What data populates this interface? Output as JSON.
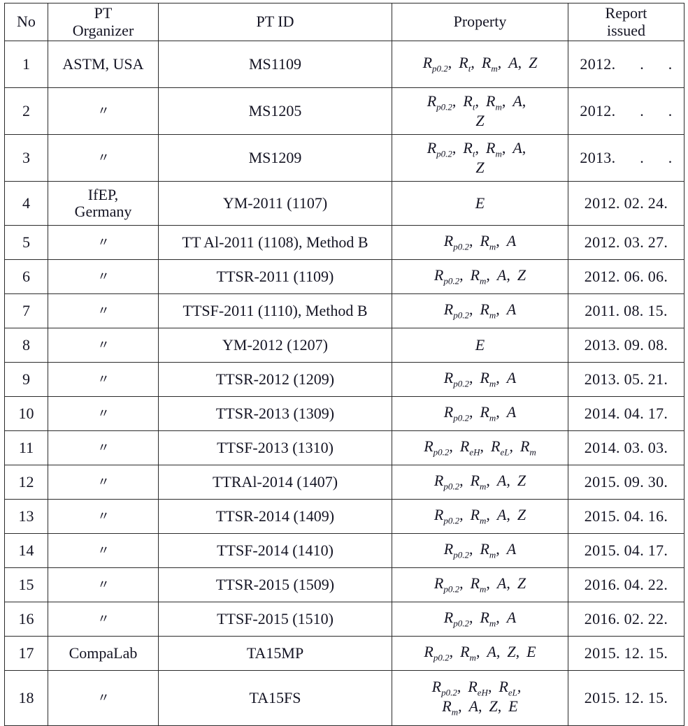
{
  "table": {
    "headers": {
      "no": "No",
      "organizer_line1": "PT",
      "organizer_line2": "Organizer",
      "pt_id": "PT  ID",
      "property": "Property",
      "report_line1": "Report",
      "report_line2": "issued"
    },
    "ditto_mark": "〃",
    "rows": [
      {
        "no": "1",
        "organizer": "ASTM,  USA",
        "organizer_is_ditto": false,
        "pt_id": "MS1109",
        "property_text": "Rp0.2,  Rt,  Rm,  A,  Z",
        "property_tokens": [
          "Rp0.2",
          "Rt",
          "Rm",
          "A",
          "Z"
        ],
        "report": "2012.      .      ."
      },
      {
        "no": "2",
        "organizer": "〃",
        "organizer_is_ditto": true,
        "pt_id": "MS1205",
        "property_text": "Rp0.2,  Rt,  Rm,  A, Z",
        "property_tokens": [
          "Rp0.2",
          "Rt",
          "Rm",
          "A",
          "Z"
        ],
        "report": "2012.      .      ."
      },
      {
        "no": "3",
        "organizer": "〃",
        "organizer_is_ditto": true,
        "pt_id": "MS1209",
        "property_text": "Rp0.2,  Rt,  Rm,  A, Z",
        "property_tokens": [
          "Rp0.2",
          "Rt",
          "Rm",
          "A",
          "Z"
        ],
        "report": "2013.      .      ."
      },
      {
        "no": "4",
        "organizer": "IfEP, Germany",
        "organizer_line1": "IfEP,",
        "organizer_line2": "Germany",
        "organizer_is_ditto": false,
        "pt_id": "YM-2011 (1107)",
        "property_text": "E",
        "property_tokens": [
          "E"
        ],
        "report": "2012. 02. 24."
      },
      {
        "no": "5",
        "organizer": "〃",
        "organizer_is_ditto": true,
        "pt_id": "TT Al-2011 (1108), Method B",
        "property_text": "Rp0.2,  Rm,  A",
        "property_tokens": [
          "Rp0.2",
          "Rm",
          "A"
        ],
        "report": "2012. 03. 27."
      },
      {
        "no": "6",
        "organizer": "〃",
        "organizer_is_ditto": true,
        "pt_id": "TTSR-2011 (1109)",
        "property_text": "Rp0.2,  Rm,  A, Z",
        "property_tokens": [
          "Rp0.2",
          "Rm",
          "A",
          "Z"
        ],
        "report": "2012. 06. 06."
      },
      {
        "no": "7",
        "organizer": "〃",
        "organizer_is_ditto": true,
        "pt_id": "TTSF-2011 (1110), Method B",
        "property_text": "Rp0.2,  Rm,  A",
        "property_tokens": [
          "Rp0.2",
          "Rm",
          "A"
        ],
        "report": "2011. 08. 15."
      },
      {
        "no": "8",
        "organizer": "〃",
        "organizer_is_ditto": true,
        "pt_id": "YM-2012 (1207)",
        "property_text": "E",
        "property_tokens": [
          "E"
        ],
        "report": "2013. 09. 08."
      },
      {
        "no": "9",
        "organizer": "〃",
        "organizer_is_ditto": true,
        "pt_id": "TTSR-2012 (1209)",
        "property_text": "Rp0.2,  Rm,  A",
        "property_tokens": [
          "Rp0.2",
          "Rm",
          "A"
        ],
        "report": "2013. 05. 21."
      },
      {
        "no": "10",
        "organizer": "〃",
        "organizer_is_ditto": true,
        "pt_id": "TTSR-2013 (1309)",
        "property_text": "Rp0.2,  Rm,  A",
        "property_tokens": [
          "Rp0.2",
          "Rm",
          "A"
        ],
        "report": "2014. 04. 17."
      },
      {
        "no": "11",
        "organizer": "〃",
        "organizer_is_ditto": true,
        "pt_id": "TTSF-2013 (1310)",
        "property_text": "Rp0.2,  ReH,  ReL,  Rm",
        "property_tokens": [
          "Rp0.2",
          "ReH",
          "ReL",
          "Rm"
        ],
        "report": "2014. 03. 03."
      },
      {
        "no": "12",
        "organizer": "〃",
        "organizer_is_ditto": true,
        "pt_id": "TTRAl-2014 (1407)",
        "property_text": "Rp0.2,  Rm,  A, Z",
        "property_tokens": [
          "Rp0.2",
          "Rm",
          "A",
          "Z"
        ],
        "report": "2015. 09. 30."
      },
      {
        "no": "13",
        "organizer": "〃",
        "organizer_is_ditto": true,
        "pt_id": "TTSR-2014 (1409)",
        "property_text": "Rp0.2,  Rm,  A, Z",
        "property_tokens": [
          "Rp0.2",
          "Rm",
          "A",
          "Z"
        ],
        "report": "2015. 04. 16."
      },
      {
        "no": "14",
        "organizer": "〃",
        "organizer_is_ditto": true,
        "pt_id": "TTSF-2014 (1410)",
        "property_text": "Rp0.2,  Rm,  A",
        "property_tokens": [
          "Rp0.2",
          "Rm",
          "A"
        ],
        "report": "2015. 04. 17."
      },
      {
        "no": "15",
        "organizer": "〃",
        "organizer_is_ditto": true,
        "pt_id": "TTSR-2015 (1509)",
        "property_text": "Rp0.2,  Rm,  A, Z",
        "property_tokens": [
          "Rp0.2",
          "Rm",
          "A",
          "Z"
        ],
        "report": "2016. 04. 22."
      },
      {
        "no": "16",
        "organizer": "〃",
        "organizer_is_ditto": true,
        "pt_id": "TTSF-2015 (1510)",
        "property_text": "Rp0.2,  Rm,  A",
        "property_tokens": [
          "Rp0.2",
          "Rm",
          "A"
        ],
        "report": "2016. 02. 22."
      },
      {
        "no": "17",
        "organizer": "CompaLab",
        "organizer_is_ditto": false,
        "pt_id": "TA15MP",
        "property_text": "Rp0.2,  Rm,  A,  Z,  E",
        "property_tokens": [
          "Rp0.2",
          "Rm",
          "A",
          "Z",
          "E"
        ],
        "report": "2015. 12. 15."
      },
      {
        "no": "18",
        "organizer": "〃",
        "organizer_is_ditto": true,
        "pt_id": "TA15FS",
        "property_text": "Rp0.2,  ReH,  ReL, Rm,  A,  Z,  E",
        "property_tokens": [
          "Rp0.2",
          "ReH",
          "ReL",
          "Rm",
          "A",
          "Z",
          "E"
        ],
        "report": "2015. 12. 15."
      }
    ]
  }
}
